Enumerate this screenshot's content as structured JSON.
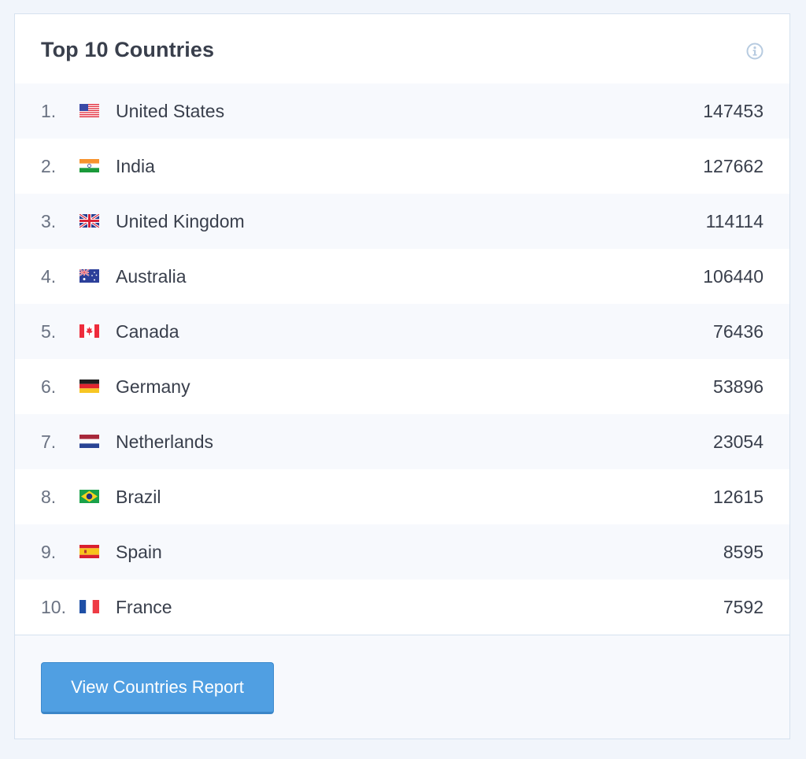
{
  "widget": {
    "title": "Top 10 Countries",
    "info_icon": "info-circle-icon"
  },
  "countries": [
    {
      "rank": "1.",
      "name": "United States",
      "count": "147453",
      "flag": "us-flag-icon"
    },
    {
      "rank": "2.",
      "name": "India",
      "count": "127662",
      "flag": "in-flag-icon"
    },
    {
      "rank": "3.",
      "name": "United Kingdom",
      "count": "114114",
      "flag": "gb-flag-icon"
    },
    {
      "rank": "4.",
      "name": "Australia",
      "count": "106440",
      "flag": "au-flag-icon"
    },
    {
      "rank": "5.",
      "name": "Canada",
      "count": "76436",
      "flag": "ca-flag-icon"
    },
    {
      "rank": "6.",
      "name": "Germany",
      "count": "53896",
      "flag": "de-flag-icon"
    },
    {
      "rank": "7.",
      "name": "Netherlands",
      "count": "23054",
      "flag": "nl-flag-icon"
    },
    {
      "rank": "8.",
      "name": "Brazil",
      "count": "12615",
      "flag": "br-flag-icon"
    },
    {
      "rank": "9.",
      "name": "Spain",
      "count": "8595",
      "flag": "es-flag-icon"
    },
    {
      "rank": "10.",
      "name": "France",
      "count": "7592",
      "flag": "fr-flag-icon"
    }
  ],
  "footer": {
    "button_label": "View Countries Report"
  },
  "colors": {
    "page_background": "#f1f5fb",
    "title_text": "#393f4c",
    "button_primary": "#509fe2",
    "info_icon": "#b7cbe0"
  }
}
